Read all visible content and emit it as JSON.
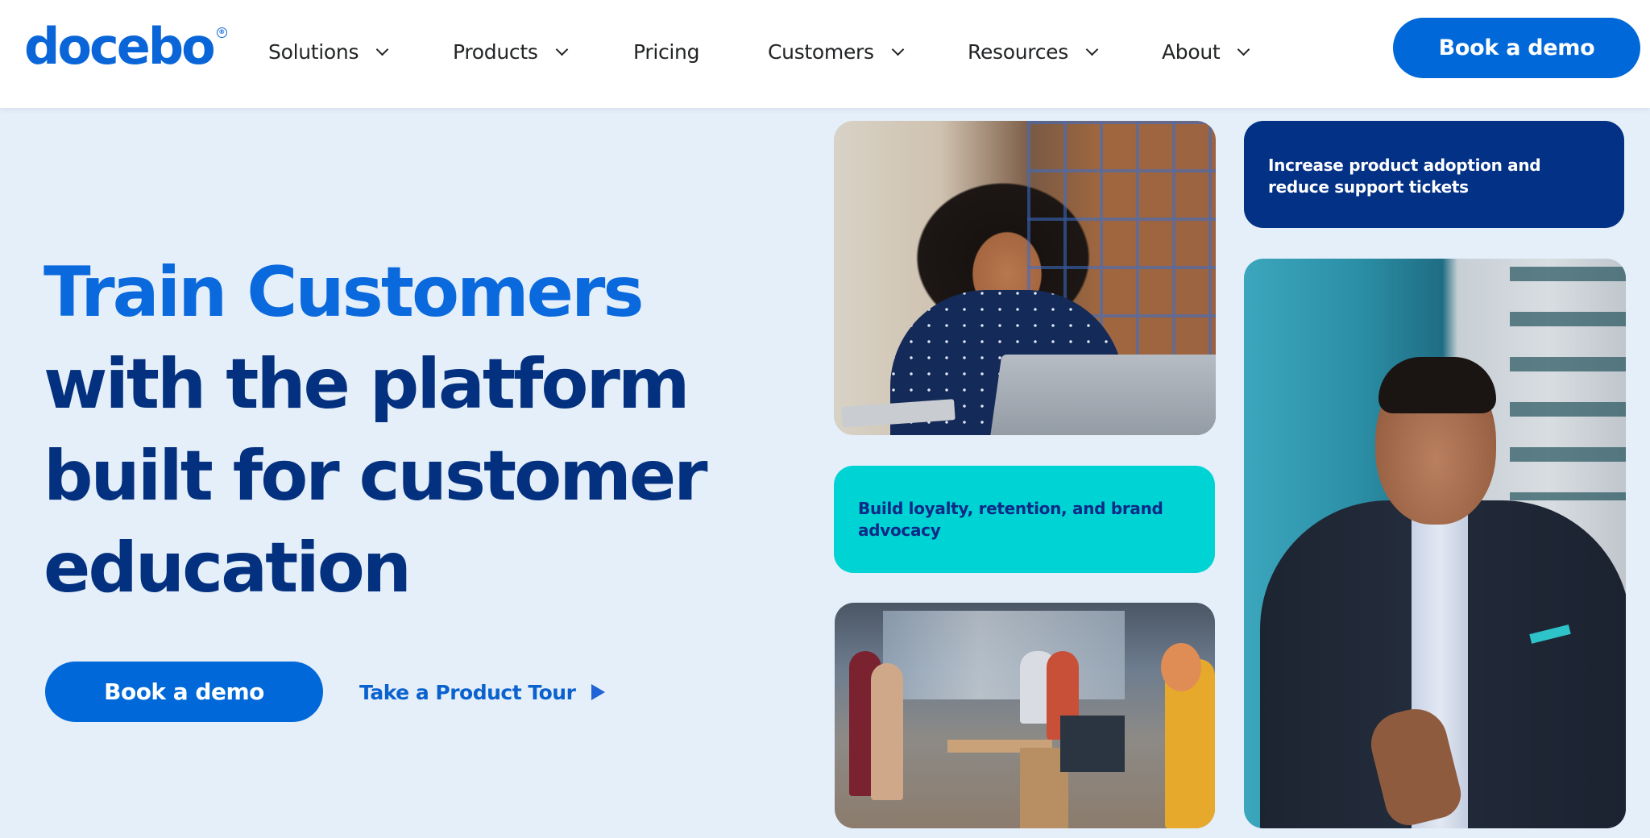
{
  "brand": {
    "logo_text": "docebo",
    "logo_mark": "®",
    "colors": {
      "primary": "#0068d8",
      "navy": "#03307f",
      "teal": "#00d3d3",
      "page_background": "#e5eff9"
    }
  },
  "nav": {
    "items": [
      {
        "label": "Solutions",
        "has_dropdown": true
      },
      {
        "label": "Products",
        "has_dropdown": true
      },
      {
        "label": "Pricing",
        "has_dropdown": false
      },
      {
        "label": "Customers",
        "has_dropdown": true
      },
      {
        "label": "Resources",
        "has_dropdown": true
      },
      {
        "label": "About",
        "has_dropdown": true
      }
    ],
    "cta_label": "Book a demo"
  },
  "hero": {
    "headline_highlight": "Train Customers",
    "headline_lines": [
      "with the platform",
      "built for customer",
      "education"
    ],
    "primary_cta_label": "Book a demo",
    "secondary_cta_label": "Take a Product Tour",
    "secondary_cta_icon": "play-triangle-icon"
  },
  "tiles": {
    "adoption_card": "Increase product adoption and reduce support tickets",
    "loyalty_card": "Build loyalty, retention, and brand advocacy",
    "photos": [
      {
        "name": "woman-with-laptop-photo",
        "description": "Smiling woman with laptop and tablet"
      },
      {
        "name": "office-team-photo",
        "description": "People working in an open office"
      },
      {
        "name": "man-in-suit-photo",
        "description": "Smiling man in a suit outdoors"
      }
    ]
  }
}
